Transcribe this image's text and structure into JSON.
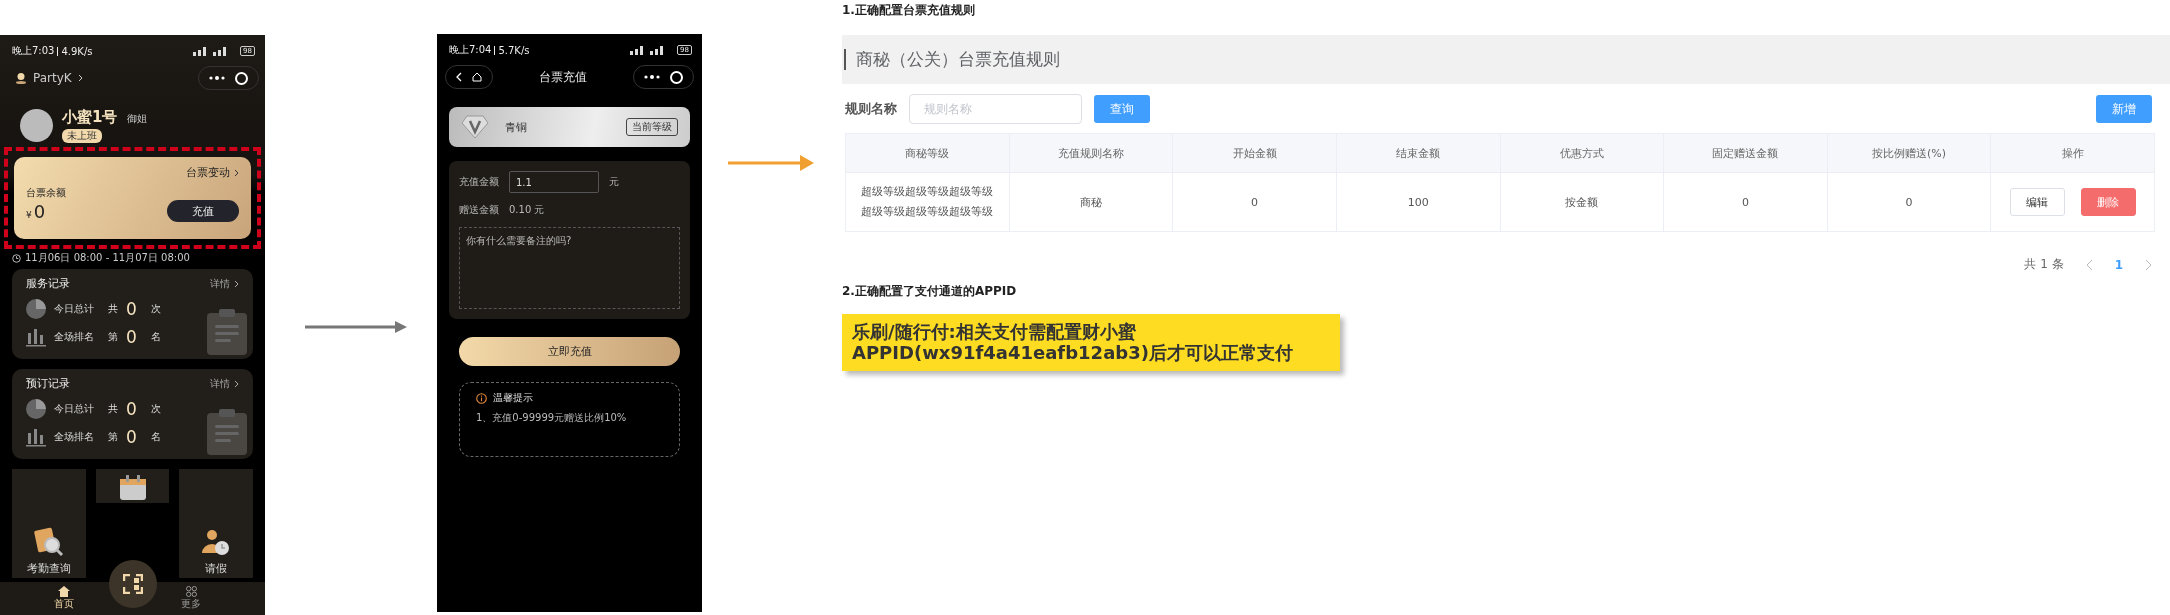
{
  "phone_home": {
    "status_bar": {
      "time": "晚上7:03",
      "speed": "4.9K/s",
      "battery": "98"
    },
    "mini_program": {
      "name": "PartyK"
    },
    "profile": {
      "name": "小蜜1号",
      "role": "御姐",
      "status": "未上班"
    },
    "balance_card": {
      "link": "台票变动",
      "label": "台票余额",
      "currency": "¥",
      "amount": "0",
      "button": "充值",
      "highlighted": true
    },
    "time_range": "11月06日 08:00 - 11月07日 08:00",
    "record_cards": [
      {
        "title": "服务记录",
        "detail": "详情",
        "rows": [
          {
            "kind": "pie",
            "label": "今日总计",
            "prefix": "共",
            "value": "0",
            "unit": "次"
          },
          {
            "kind": "bars",
            "label": "全场排名",
            "prefix": "第",
            "value": "0",
            "unit": "名"
          }
        ]
      },
      {
        "title": "预订记录",
        "detail": "详情",
        "rows": [
          {
            "kind": "pie",
            "label": "今日总计",
            "prefix": "共",
            "value": "0",
            "unit": "次"
          },
          {
            "kind": "bars",
            "label": "全场排名",
            "prefix": "第",
            "value": "0",
            "unit": "名"
          }
        ]
      }
    ],
    "tiles": [
      {
        "kind": "search",
        "label": "考勤查询"
      },
      {
        "kind": "calendar"
      },
      {
        "kind": "leave",
        "label": "请假"
      }
    ],
    "tab_bar": [
      {
        "kind": "home",
        "label": "首页",
        "selected": true
      },
      {
        "kind": "grid",
        "label": "更多",
        "selected": false
      }
    ]
  },
  "phone_recharge": {
    "status_bar": {
      "time": "晚上7:04",
      "speed": "5.7K/s",
      "battery": "98"
    },
    "title": "台票充值",
    "level": {
      "name": "青铜",
      "badge": "当前等级"
    },
    "form": {
      "amount_label": "充值金额",
      "amount_value": "1.1",
      "amount_unit": "元",
      "gift_label": "赠送金额",
      "gift_value": "0.10 元",
      "note_placeholder": "你有什么需要备注的吗?"
    },
    "submit": "立即充值",
    "tips": {
      "title": "温馨提示",
      "items": [
        "1、充值0-99999元赠送比例10%"
      ]
    }
  },
  "admin": {
    "section1_heading": "1.正确配置台票充值规则",
    "panel_title": "商秘（公关）台票充值规则",
    "filter": {
      "label": "规则名称",
      "placeholder": "规则名称",
      "search_button": "查询",
      "add_button": "新增"
    },
    "table": {
      "columns": [
        "商秘等级",
        "充值规则名称",
        "开始金额",
        "结束金额",
        "优惠方式",
        "固定赠送金额",
        "按比例赠送(%)",
        "操作"
      ],
      "rows": [
        {
          "cells": [
            "超级等级超级等级超级等级超级等级超级等级超级等级",
            "商秘",
            "0",
            "100",
            "按金额",
            "0",
            "0"
          ],
          "actions": [
            "编辑",
            "删除"
          ]
        }
      ]
    },
    "pagination": {
      "total": "共 1 条",
      "pages": [
        {
          "label": "1",
          "selected": true
        }
      ]
    },
    "section2_heading": "2.正确配置了支付通道的APPID",
    "notice": {
      "lines": [
        "乐刷/随行付:相关支付需配置财小蜜",
        "APPID(wx91f4a41eafb12ab3)后才可以正常支付"
      ]
    }
  }
}
